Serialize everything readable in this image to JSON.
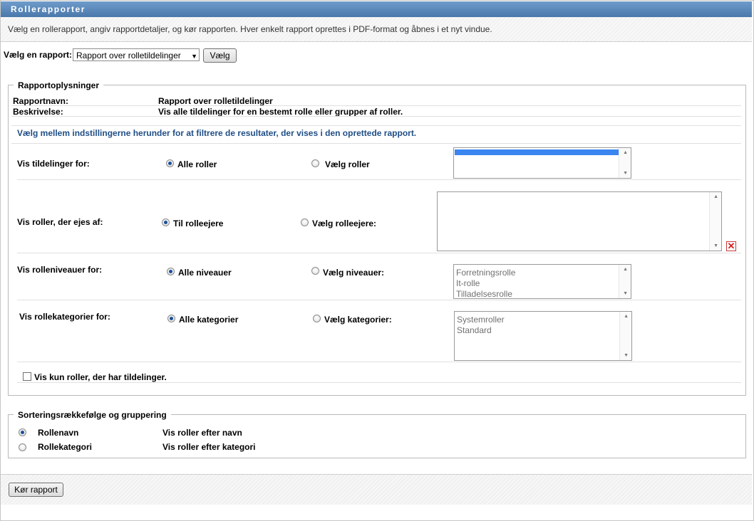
{
  "window": {
    "title": "Rollerapporter"
  },
  "intro": "Vælg en rollerapport, angiv rapportdetaljer, og kør rapporten. Hver enkelt rapport oprettes i PDF-format og åbnes i et nyt vindue.",
  "report_select": {
    "label": "Vælg en rapport:",
    "value": "Rapport over rolletildelinger",
    "button": "Vælg"
  },
  "info": {
    "legend": "Rapportoplysninger",
    "name_label": "Rapportnavn:",
    "name_value": "Rapport over rolletildelinger",
    "desc_label": "Beskrivelse:",
    "desc_value": "Vis alle tildelinger for en bestemt rolle eller grupper af roller.",
    "note": "Vælg mellem indstillingerne herunder for at filtrere de resultater, der vises i den oprettede rapport."
  },
  "filters": {
    "assignments": {
      "label": "Vis tildelinger for:",
      "opt_all": "Alle roller",
      "opt_select": "Vælg roller"
    },
    "owners": {
      "label": "Vis roller, der ejes af:",
      "opt_all": "Til rolleejere",
      "opt_select": "Vælg rolleejere:"
    },
    "levels": {
      "label": "Vis rolleniveauer for:",
      "opt_all": "Alle niveauer",
      "opt_select": "Vælg niveauer:",
      "options": [
        "Forretningsrolle",
        "It-rolle",
        "Tilladelsesrolle"
      ]
    },
    "categories": {
      "label": "Vis rollekategorier for:",
      "opt_all": "Alle kategorier",
      "opt_select": "Vælg kategorier:",
      "options": [
        "Systemroller",
        "Standard"
      ]
    },
    "only_with_assignments": "Vis kun roller, der har tildelinger."
  },
  "sort": {
    "legend": "Sorteringsrækkefølge og gruppering",
    "options": [
      {
        "label": "Rollenavn",
        "desc": "Vis roller efter navn",
        "selected": true
      },
      {
        "label": "Rollekategori",
        "desc": "Vis roller efter kategori",
        "selected": false
      }
    ]
  },
  "run_button": "Kør rapport"
}
